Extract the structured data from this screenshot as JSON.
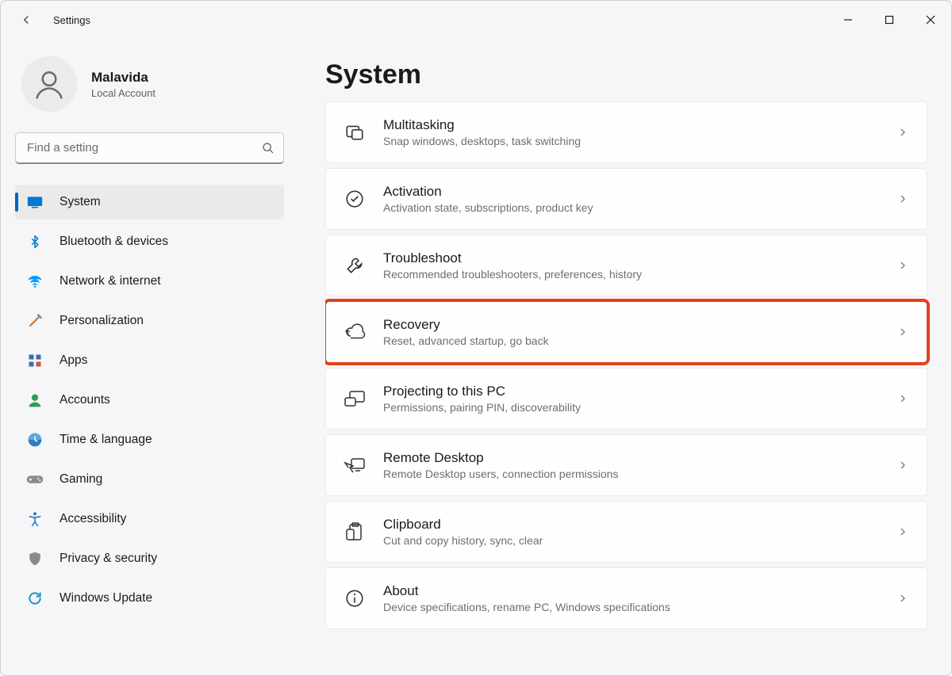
{
  "window": {
    "title": "Settings"
  },
  "profile": {
    "name": "Malavida",
    "subtitle": "Local Account"
  },
  "search": {
    "placeholder": "Find a setting"
  },
  "nav": {
    "items": [
      {
        "id": "system",
        "label": "System",
        "selected": true,
        "iconColor": "#0078d4"
      },
      {
        "id": "bluetooth",
        "label": "Bluetooth & devices",
        "selected": false,
        "iconColor": "#0078d4"
      },
      {
        "id": "network",
        "label": "Network & internet",
        "selected": false,
        "iconColor": "#0099ff"
      },
      {
        "id": "personalization",
        "label": "Personalization",
        "selected": false,
        "iconColor": "#d97f2e"
      },
      {
        "id": "apps",
        "label": "Apps",
        "selected": false,
        "iconColor": "#3b6fa6"
      },
      {
        "id": "accounts",
        "label": "Accounts",
        "selected": false,
        "iconColor": "#2e9d5c"
      },
      {
        "id": "time",
        "label": "Time & language",
        "selected": false,
        "iconColor": "#2e7bc6"
      },
      {
        "id": "gaming",
        "label": "Gaming",
        "selected": false,
        "iconColor": "#8a8a8a"
      },
      {
        "id": "accessibility",
        "label": "Accessibility",
        "selected": false,
        "iconColor": "#2e7bc6"
      },
      {
        "id": "privacy",
        "label": "Privacy & security",
        "selected": false,
        "iconColor": "#8a8a8a"
      },
      {
        "id": "windowsupdate",
        "label": "Windows Update",
        "selected": false,
        "iconColor": "#1597c2"
      }
    ]
  },
  "page": {
    "heading": "System",
    "items": [
      {
        "id": "multitasking",
        "title": "Multitasking",
        "subtitle": "Snap windows, desktops, task switching",
        "highlighted": false
      },
      {
        "id": "activation",
        "title": "Activation",
        "subtitle": "Activation state, subscriptions, product key",
        "highlighted": false
      },
      {
        "id": "troubleshoot",
        "title": "Troubleshoot",
        "subtitle": "Recommended troubleshooters, preferences, history",
        "highlighted": false
      },
      {
        "id": "recovery",
        "title": "Recovery",
        "subtitle": "Reset, advanced startup, go back",
        "highlighted": true
      },
      {
        "id": "projecting",
        "title": "Projecting to this PC",
        "subtitle": "Permissions, pairing PIN, discoverability",
        "highlighted": false
      },
      {
        "id": "remotedesktop",
        "title": "Remote Desktop",
        "subtitle": "Remote Desktop users, connection permissions",
        "highlighted": false
      },
      {
        "id": "clipboard",
        "title": "Clipboard",
        "subtitle": "Cut and copy history, sync, clear",
        "highlighted": false
      },
      {
        "id": "about",
        "title": "About",
        "subtitle": "Device specifications, rename PC, Windows specifications",
        "highlighted": false
      }
    ]
  }
}
